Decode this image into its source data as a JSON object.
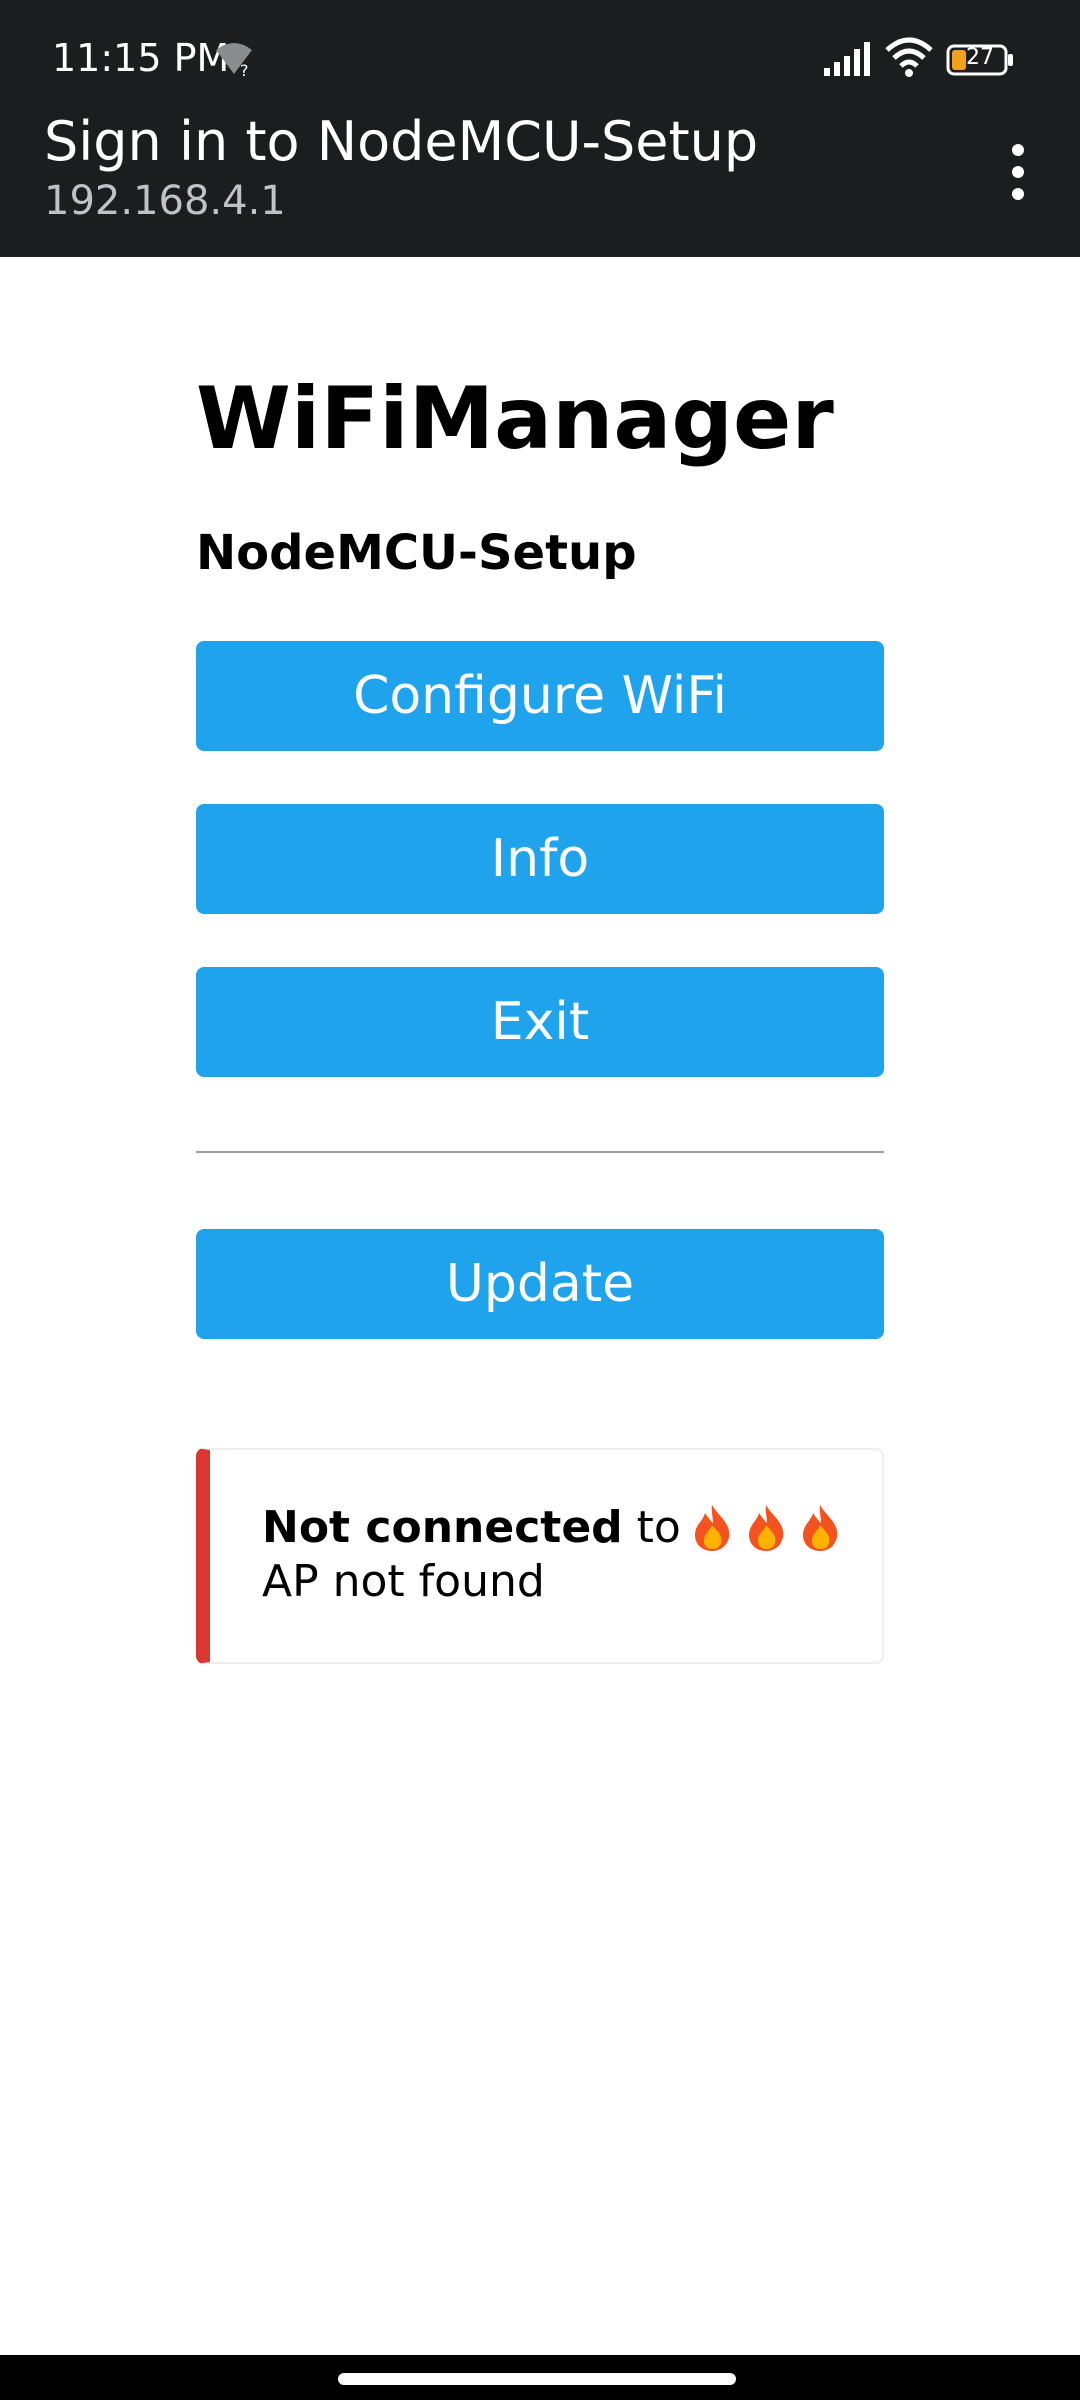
{
  "status_bar": {
    "time": "11:15 PM",
    "battery_level": "27",
    "icons": [
      "wifi-no-internet-icon",
      "signal-bars-icon",
      "wifi-icon",
      "battery-icon"
    ]
  },
  "app_bar": {
    "title": "Sign in to NodeMCU-Setup",
    "subtitle": "192.168.4.1",
    "menu_icon": "more-vertical-icon"
  },
  "page": {
    "title": "WiFiManager",
    "device_name": "NodeMCU-Setup",
    "buttons": {
      "configure": "Configure WiFi",
      "info": "Info",
      "exit": "Exit",
      "update": "Update"
    },
    "status_message": {
      "bold": "Not connected",
      "rest": " to",
      "ssid_icons": [
        "fire-emoji-icon",
        "fire-emoji-icon",
        "fire-emoji-icon"
      ],
      "detail": "AP not found",
      "accent_color": "#dc3630"
    }
  },
  "colors": {
    "button": "#1fa3ec",
    "top_bar": "#1b1d1f"
  }
}
